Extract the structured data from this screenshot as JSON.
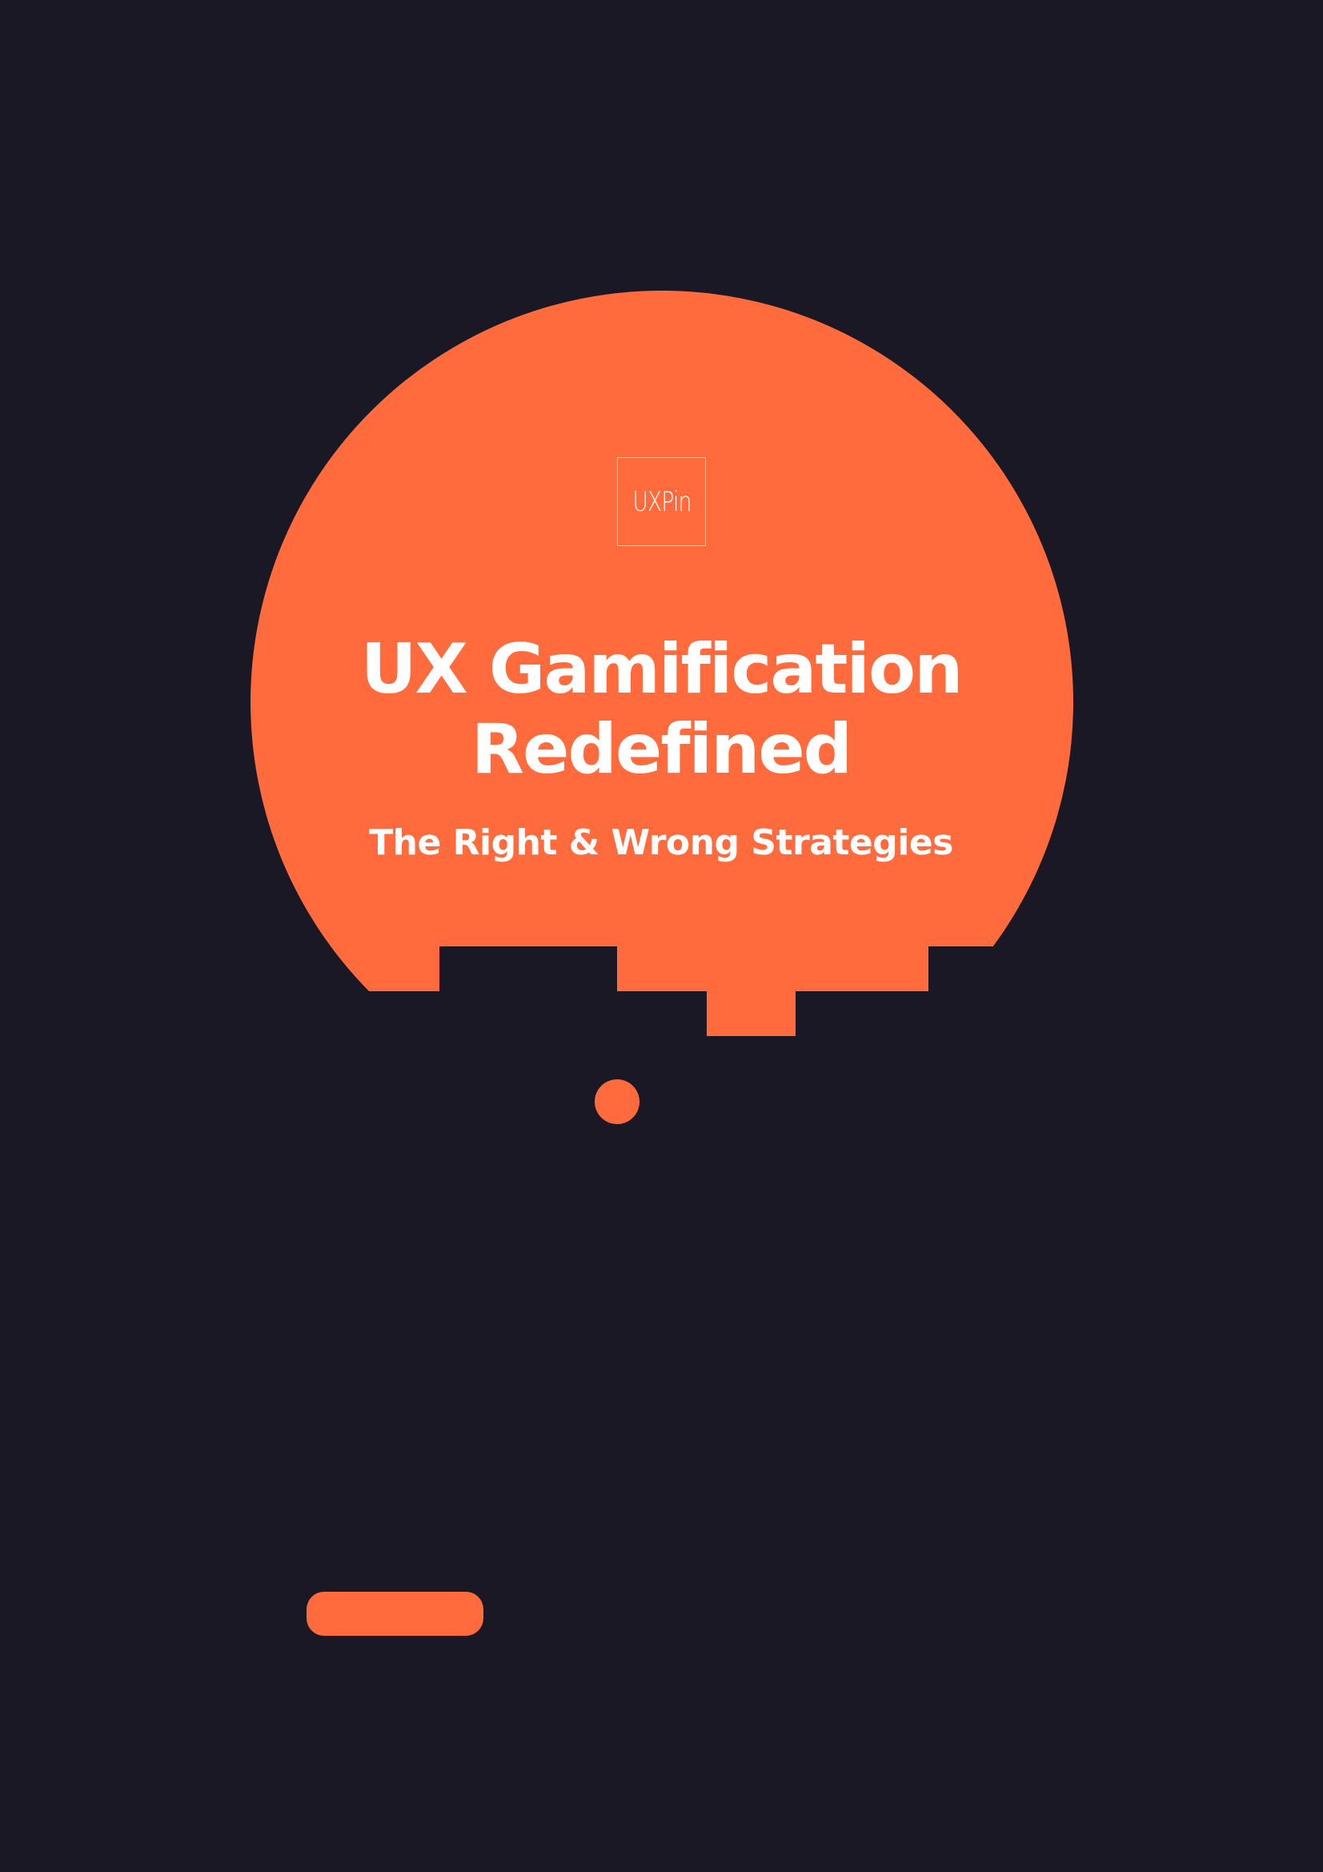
{
  "colors": {
    "background": "#1a1825",
    "accent": "#ff6b3d",
    "text": "#ffffff"
  },
  "logo": {
    "text": "UXPin"
  },
  "title": {
    "line1": "UX Gamification",
    "line2": "Redefined"
  },
  "subtitle": "The Right & Wrong Strategies"
}
